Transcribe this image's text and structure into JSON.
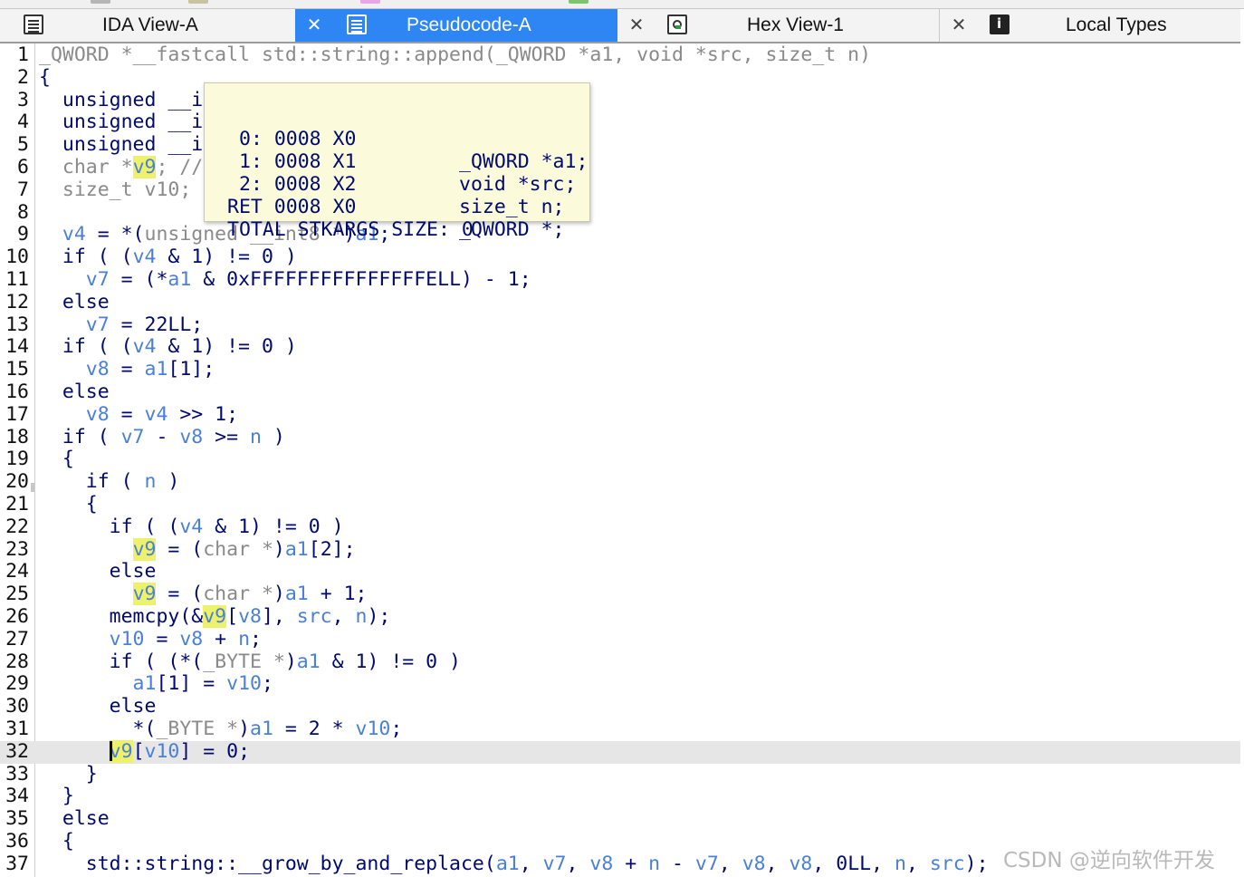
{
  "tabs": [
    {
      "label": "IDA View-A",
      "icon": "list-icon",
      "active": false
    },
    {
      "label": "Pseudocode-A",
      "icon": "list-icon",
      "active": true
    },
    {
      "label": "Hex View-1",
      "icon": "hex-icon",
      "active": false
    },
    {
      "label": "Local Types",
      "icon": "info-icon",
      "active": false
    }
  ],
  "code_lines": [
    {
      "n": "1",
      "segs": [
        [
          "g",
          "_QWORD *__fastcall std::string::append(_QWORD *a1, void *src, size_t n)"
        ]
      ]
    },
    {
      "n": "2",
      "segs": [
        [
          "k",
          "{"
        ]
      ]
    },
    {
      "n": "3",
      "segs": [
        [
          "k",
          "  unsigned __int8 v4; // w8"
        ]
      ]
    },
    {
      "n": "4",
      "segs": [
        [
          "k",
          "  unsigned __int64 v7; // x9"
        ]
      ]
    },
    {
      "n": "5",
      "segs": [
        [
          "k",
          "  unsigned __int64 v8; // x10"
        ]
      ]
    },
    {
      "n": "6",
      "segs": [
        [
          "g",
          "  char *"
        ],
        [
          "hl",
          "v9"
        ],
        [
          "g",
          "; // x8"
        ]
      ]
    },
    {
      "n": "7",
      "segs": [
        [
          "g",
          "  size_t v10; // x9"
        ]
      ]
    },
    {
      "n": "8",
      "segs": [
        [
          "k",
          ""
        ]
      ]
    },
    {
      "n": "9",
      "segs": [
        [
          "v",
          "  v4"
        ],
        [
          "k",
          " = *("
        ],
        [
          "g",
          "unsigned __int8 *"
        ],
        [
          "k",
          ")"
        ],
        [
          "v",
          "a1"
        ],
        [
          "k",
          ";"
        ]
      ]
    },
    {
      "n": "10",
      "segs": [
        [
          "k",
          "  if ( ("
        ],
        [
          "v",
          "v4"
        ],
        [
          "k",
          " & 1) != 0 )"
        ]
      ]
    },
    {
      "n": "11",
      "segs": [
        [
          "v",
          "    v7"
        ],
        [
          "k",
          " = (*"
        ],
        [
          "v",
          "a1"
        ],
        [
          "k",
          " & 0xFFFFFFFFFFFFFFFELL) - 1;"
        ]
      ]
    },
    {
      "n": "12",
      "segs": [
        [
          "k",
          "  else"
        ]
      ]
    },
    {
      "n": "13",
      "segs": [
        [
          "v",
          "    v7"
        ],
        [
          "k",
          " = 22LL;"
        ]
      ]
    },
    {
      "n": "14",
      "segs": [
        [
          "k",
          "  if ( ("
        ],
        [
          "v",
          "v4"
        ],
        [
          "k",
          " & 1) != 0 )"
        ]
      ]
    },
    {
      "n": "15",
      "segs": [
        [
          "v",
          "    v8"
        ],
        [
          "k",
          " = "
        ],
        [
          "v",
          "a1"
        ],
        [
          "k",
          "[1];"
        ]
      ]
    },
    {
      "n": "16",
      "segs": [
        [
          "k",
          "  else"
        ]
      ]
    },
    {
      "n": "17",
      "segs": [
        [
          "v",
          "    v8"
        ],
        [
          "k",
          " = "
        ],
        [
          "v",
          "v4"
        ],
        [
          "k",
          " >> 1;"
        ]
      ]
    },
    {
      "n": "18",
      "segs": [
        [
          "k",
          "  if ( "
        ],
        [
          "v",
          "v7"
        ],
        [
          "k",
          " - "
        ],
        [
          "v",
          "v8"
        ],
        [
          "k",
          " >= "
        ],
        [
          "v",
          "n"
        ],
        [
          "k",
          " )"
        ]
      ]
    },
    {
      "n": "19",
      "segs": [
        [
          "k",
          "  {"
        ]
      ]
    },
    {
      "n": "20",
      "segs": [
        [
          "k",
          "    if ( "
        ],
        [
          "v",
          "n"
        ],
        [
          "k",
          " )"
        ]
      ]
    },
    {
      "n": "21",
      "segs": [
        [
          "k",
          "    {"
        ]
      ]
    },
    {
      "n": "22",
      "segs": [
        [
          "k",
          "      if ( ("
        ],
        [
          "v",
          "v4"
        ],
        [
          "k",
          " & 1) != 0 )"
        ]
      ]
    },
    {
      "n": "23",
      "segs": [
        [
          "k",
          "        "
        ],
        [
          "hl",
          "v9"
        ],
        [
          "k",
          " = ("
        ],
        [
          "g",
          "char *"
        ],
        [
          "k",
          ")"
        ],
        [
          "v",
          "a1"
        ],
        [
          "k",
          "[2];"
        ]
      ]
    },
    {
      "n": "24",
      "segs": [
        [
          "k",
          "      else"
        ]
      ]
    },
    {
      "n": "25",
      "segs": [
        [
          "k",
          "        "
        ],
        [
          "hl",
          "v9"
        ],
        [
          "k",
          " = ("
        ],
        [
          "g",
          "char *"
        ],
        [
          "k",
          ")"
        ],
        [
          "v",
          "a1"
        ],
        [
          "k",
          " + 1;"
        ]
      ]
    },
    {
      "n": "26",
      "segs": [
        [
          "k",
          "      memcpy(&"
        ],
        [
          "hl",
          "v9"
        ],
        [
          "k",
          "["
        ],
        [
          "v",
          "v8"
        ],
        [
          "k",
          "], "
        ],
        [
          "v",
          "src"
        ],
        [
          "k",
          ", "
        ],
        [
          "v",
          "n"
        ],
        [
          "k",
          ");"
        ]
      ]
    },
    {
      "n": "27",
      "segs": [
        [
          "v",
          "      v10"
        ],
        [
          "k",
          " = "
        ],
        [
          "v",
          "v8"
        ],
        [
          "k",
          " + "
        ],
        [
          "v",
          "n"
        ],
        [
          "k",
          ";"
        ]
      ]
    },
    {
      "n": "28",
      "segs": [
        [
          "k",
          "      if ( (*("
        ],
        [
          "g",
          "_BYTE *"
        ],
        [
          "k",
          ")"
        ],
        [
          "v",
          "a1"
        ],
        [
          "k",
          " & 1) != 0 )"
        ]
      ]
    },
    {
      "n": "29",
      "segs": [
        [
          "v",
          "        a1"
        ],
        [
          "k",
          "[1] = "
        ],
        [
          "v",
          "v10"
        ],
        [
          "k",
          ";"
        ]
      ]
    },
    {
      "n": "30",
      "segs": [
        [
          "k",
          "      else"
        ]
      ]
    },
    {
      "n": "31",
      "segs": [
        [
          "k",
          "        *("
        ],
        [
          "g",
          "_BYTE *"
        ],
        [
          "k",
          ")"
        ],
        [
          "v",
          "a1"
        ],
        [
          "k",
          " = 2 * "
        ],
        [
          "v",
          "v10"
        ],
        [
          "k",
          ";"
        ]
      ]
    },
    {
      "n": "32",
      "current": true,
      "segs": [
        [
          "k",
          "      "
        ],
        [
          "cursor",
          ""
        ],
        [
          "hl",
          "v9"
        ],
        [
          "k",
          "["
        ],
        [
          "v",
          "v10"
        ],
        [
          "k",
          "] = 0;"
        ]
      ]
    },
    {
      "n": "33",
      "segs": [
        [
          "k",
          "    }"
        ]
      ]
    },
    {
      "n": "34",
      "segs": [
        [
          "k",
          "  }"
        ]
      ]
    },
    {
      "n": "35",
      "segs": [
        [
          "k",
          "  else"
        ]
      ]
    },
    {
      "n": "36",
      "segs": [
        [
          "k",
          "  {"
        ]
      ]
    },
    {
      "n": "37",
      "segs": [
        [
          "k",
          "    std::string::__grow_by_and_replace("
        ],
        [
          "v",
          "a1"
        ],
        [
          "k",
          ", "
        ],
        [
          "v",
          "v7"
        ],
        [
          "k",
          ", "
        ],
        [
          "v",
          "v8"
        ],
        [
          "k",
          " + "
        ],
        [
          "v",
          "n"
        ],
        [
          "k",
          " - "
        ],
        [
          "v",
          "v7"
        ],
        [
          "k",
          ", "
        ],
        [
          "v",
          "v8"
        ],
        [
          "k",
          ", "
        ],
        [
          "v",
          "v8"
        ],
        [
          "k",
          ", 0LL, "
        ],
        [
          "v",
          "n"
        ],
        [
          "k",
          ", "
        ],
        [
          "v",
          "src"
        ],
        [
          "k",
          ");"
        ]
      ]
    }
  ],
  "hint": {
    "rows": [
      {
        "left": "0: 0008 X0",
        "right": "_QWORD *a1;"
      },
      {
        "left": "1: 0008 X1",
        "right": "void *src;"
      },
      {
        "left": "2: 0008 X2",
        "right": "size_t n;"
      },
      {
        "left": "RET 0008 X0",
        "right": "_QWORD *;"
      }
    ],
    "total": "TOTAL STKARGS SIZE: 0"
  },
  "watermark": "CSDN @逆向软件开发",
  "colors": {
    "accent": "#2e86f5",
    "keyword": "#000a6e",
    "variable": "#4a80d8",
    "highlight": "#eef26b",
    "hint_bg": "#fbfbdc"
  }
}
